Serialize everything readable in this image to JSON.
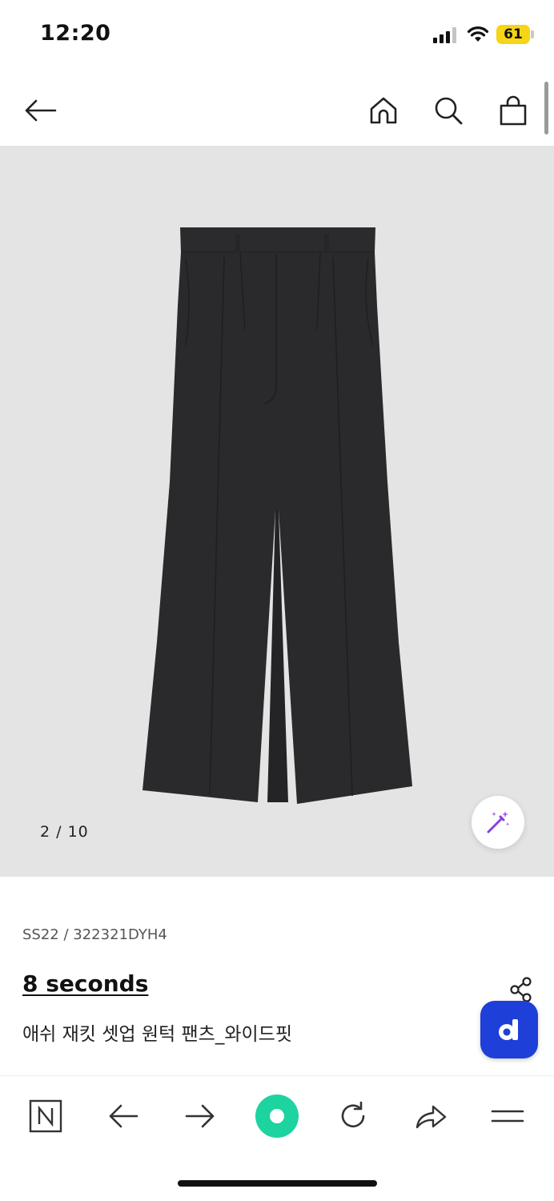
{
  "status_bar": {
    "time": "12:20",
    "battery_level": "61",
    "battery_color": "#f5d515"
  },
  "header": {
    "back_icon": "arrow-left-icon",
    "home_icon": "home-icon",
    "search_icon": "search-icon",
    "cart_icon": "shopping-bag-icon"
  },
  "gallery": {
    "counter": "2 / 10",
    "background_color": "#e4e4e4",
    "magic_icon": "magic-wand-icon"
  },
  "product": {
    "code": "SS22 / 322321DYH4",
    "brand": "8 seconds",
    "name": "애쉬 재킷 셋업 원턱 팬츠_와이드핏"
  },
  "floating": {
    "share_icon": "share-icon",
    "d_button_label": "d",
    "d_button_color": "#1e3fd8"
  },
  "toolbar": {
    "items": [
      {
        "icon": "naver-n-icon",
        "label": "N"
      },
      {
        "icon": "back-arrow-icon"
      },
      {
        "icon": "forward-arrow-icon"
      },
      {
        "icon": "green-dot-icon",
        "color": "#1dd3a0"
      },
      {
        "icon": "reload-icon"
      },
      {
        "icon": "share-forward-icon"
      },
      {
        "icon": "menu-icon"
      }
    ]
  }
}
